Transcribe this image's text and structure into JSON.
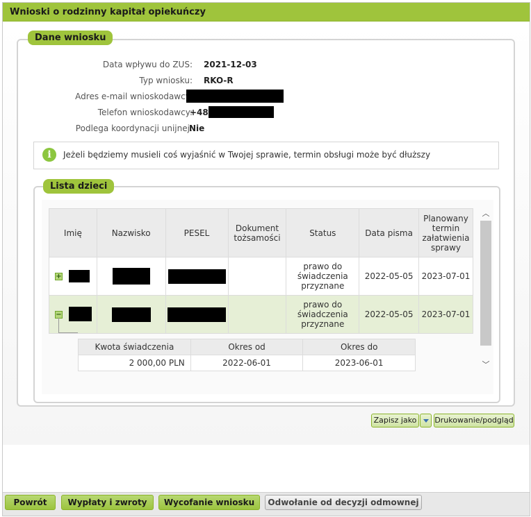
{
  "window": {
    "title": "Wnioski o rodzinny kapitał opiekuńczy"
  },
  "application": {
    "panel_title": "Dane wniosku",
    "fields": [
      {
        "label": "Data wpływu do ZUS:",
        "value": "2021-12-03"
      },
      {
        "label": "Typ wniosku:",
        "value": "RKO-R"
      },
      {
        "label": "Adres e-mail wnioskodawcy:",
        "value": ""
      },
      {
        "label": "Telefon wnioskodawcy:",
        "value": "+48"
      },
      {
        "label": "Podlega koordynacji unijnej:",
        "value": "Nie"
      }
    ],
    "info_icon": "info-icon",
    "info_text": "Jeżeli będziemy musieli coś wyjaśnić w Twojej sprawie, termin obsługi może być dłuższy"
  },
  "children": {
    "panel_title": "Lista dzieci",
    "columns": [
      "Imię",
      "Nazwisko",
      "PESEL",
      "Dokument tożsamości",
      "Status",
      "Data pisma",
      "Planowany termin załatwienia sprawy"
    ],
    "rows": [
      {
        "expander": "+",
        "status": "prawo do świadczenia przyznane",
        "letter_date": "2022-05-05",
        "planned_date": "2023-07-01"
      },
      {
        "expander": "−",
        "status": "prawo do świadczenia przyznane",
        "letter_date": "2022-05-05",
        "planned_date": "2023-07-01"
      }
    ],
    "details": {
      "columns": [
        "Kwota świadczenia",
        "Okres od",
        "Okres do"
      ],
      "row": {
        "amount": "2 000,00 PLN",
        "from": "2022-06-01",
        "to": "2023-06-01"
      }
    }
  },
  "actions": {
    "save_as": "Zapisz jako",
    "print": "Drukowanie/podgląd"
  },
  "footer": {
    "back": "Powrót",
    "payments": "Wypłaty i zwroty",
    "withdraw": "Wycofanie wniosku",
    "appeal": "Odwołanie od decyzji odmownej"
  },
  "colors": {
    "accent": "#9fc43c",
    "row_highlight": "#e6efd6"
  }
}
